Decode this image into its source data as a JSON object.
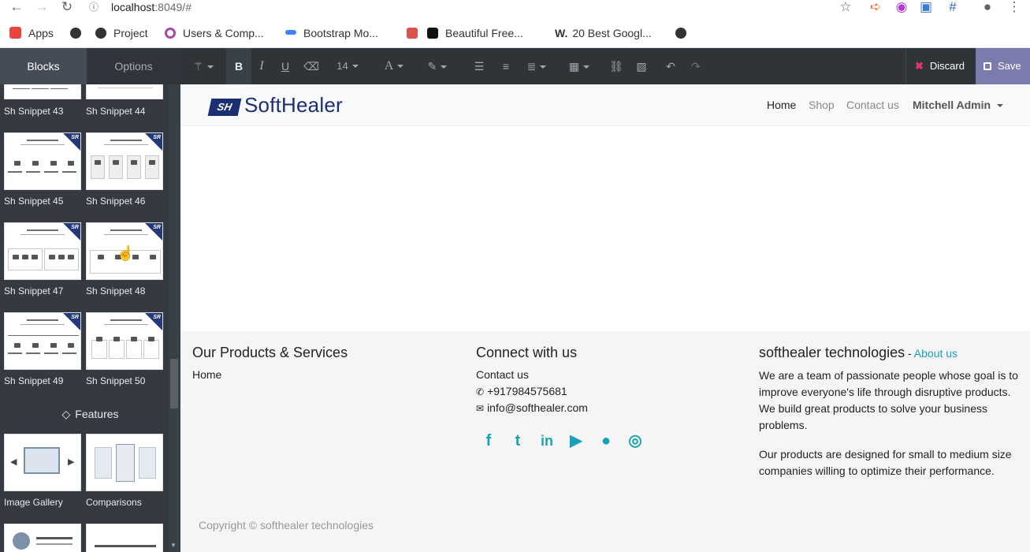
{
  "browser": {
    "url_host": "localhost",
    "url_path": ":8049/#",
    "bookmarks": [
      {
        "label": "Apps",
        "color": "#e8453c"
      },
      {
        "label": "",
        "color": "#333333"
      },
      {
        "label": "Project",
        "color": "#333333"
      },
      {
        "label": "Users & Comp...",
        "color": "#a64ca6"
      },
      {
        "label": "Bootstrap Mo...",
        "color": "#3f82f7"
      },
      {
        "label": "Beautiful Free...",
        "color": "#d9534f"
      },
      {
        "label": "20 Best Googl...",
        "color": "#111111"
      },
      {
        "label": "",
        "color": "#333333"
      }
    ]
  },
  "editor": {
    "tabs": {
      "blocks": "Blocks",
      "options": "Options"
    },
    "font_size": "14",
    "discard_label": "Discard",
    "save_label": "Save"
  },
  "snippets": [
    {
      "label": "Sh Snippet 43"
    },
    {
      "label": "Sh Snippet 44"
    },
    {
      "label": "Sh Snippet 45"
    },
    {
      "label": "Sh Snippet 46"
    },
    {
      "label": "Sh Snippet 47"
    },
    {
      "label": "Sh Snippet 48"
    },
    {
      "label": "Sh Snippet 49"
    },
    {
      "label": "Sh Snippet 50"
    }
  ],
  "features": {
    "heading": "Features",
    "items": [
      {
        "label": "Image Gallery"
      },
      {
        "label": "Comparisons"
      }
    ]
  },
  "site": {
    "logo_text": "SoftHealer",
    "nav": {
      "home": "Home",
      "shop": "Shop",
      "contact": "Contact us",
      "user": "Mitchell Admin"
    },
    "footer": {
      "col1_title": "Our Products & Services",
      "col1_link": "Home",
      "col2_title": "Connect with us",
      "col2_link": "Contact us",
      "phone": "+917984575681",
      "email": "info@softhealer.com",
      "col3_title": "softhealer technologies",
      "col3_sep": " - ",
      "col3_link": "About us",
      "para1": "We are a team of passionate people whose goal is to improve everyone's life through disruptive products. We build great products to solve your business problems.",
      "para2": "Our products are designed for small to medium size companies willing to optimize their performance.",
      "copyright": "Copyright © softhealer technologies"
    },
    "accent_color": "#17a2b8"
  }
}
